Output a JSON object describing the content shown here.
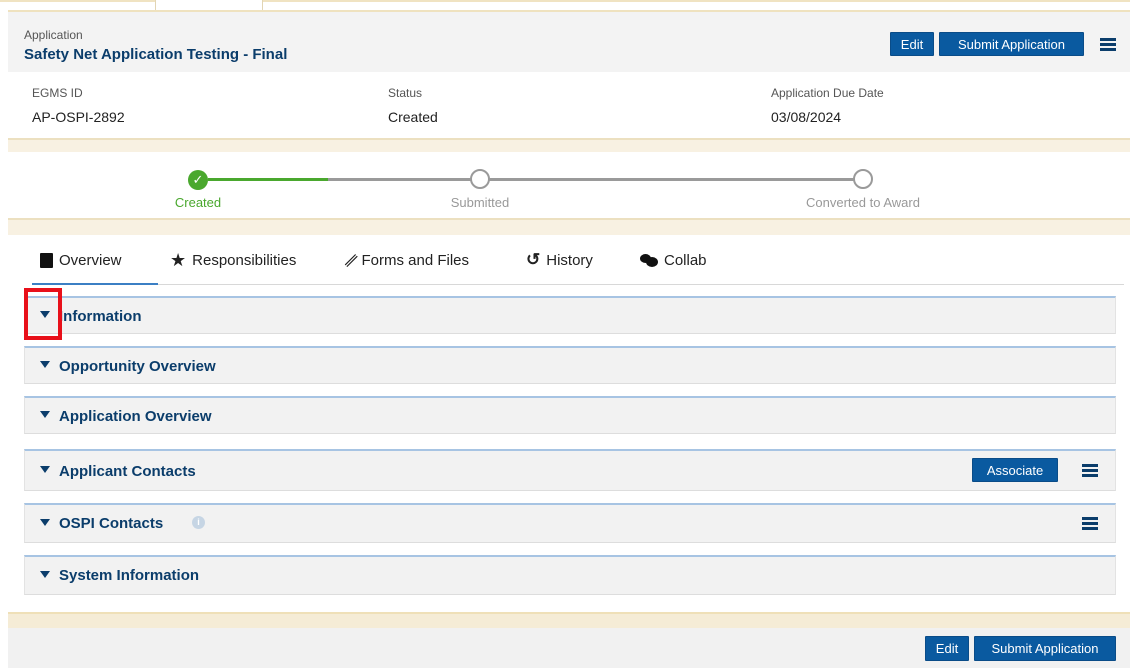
{
  "header": {
    "label": "Application",
    "title": "Safety Net Application Testing - Final",
    "edit_label": "Edit",
    "submit_label": "Submit Application"
  },
  "info": {
    "egms_id": {
      "label": "EGMS ID",
      "value": "AP-OSPI-2892"
    },
    "status": {
      "label": "Status",
      "value": "Created"
    },
    "due_date": {
      "label": "Application Due Date",
      "value": "03/08/2024"
    }
  },
  "progress": {
    "steps": [
      {
        "label": "Created",
        "state": "complete",
        "color": "#4aa82e"
      },
      {
        "label": "Submitted",
        "state": "pending",
        "color": "#999999"
      },
      {
        "label": "Converted to Award",
        "state": "pending",
        "color": "#999999"
      }
    ]
  },
  "tabs": [
    {
      "label": "Overview",
      "icon": "book-icon",
      "active": true
    },
    {
      "label": "Responsibilities",
      "icon": "star-icon",
      "active": false
    },
    {
      "label": "Forms and Files",
      "icon": "paperclip-icon",
      "active": false
    },
    {
      "label": "History",
      "icon": "history-icon",
      "active": false
    },
    {
      "label": "Collab",
      "icon": "chat-icon",
      "active": false
    }
  ],
  "sections": [
    {
      "title": "Information"
    },
    {
      "title": "Opportunity Overview"
    },
    {
      "title": "Application Overview"
    },
    {
      "title": "Applicant Contacts",
      "button": "Associate"
    },
    {
      "title": "OSPI Contacts",
      "info_icon": "i"
    },
    {
      "title": "System Information"
    }
  ],
  "footer": {
    "edit_label": "Edit",
    "submit_label": "Submit Application"
  },
  "colors": {
    "accent": "#0a5aa0",
    "heading": "#0b3d6b",
    "success": "#4aa82e",
    "highlight": "#e8101a"
  }
}
